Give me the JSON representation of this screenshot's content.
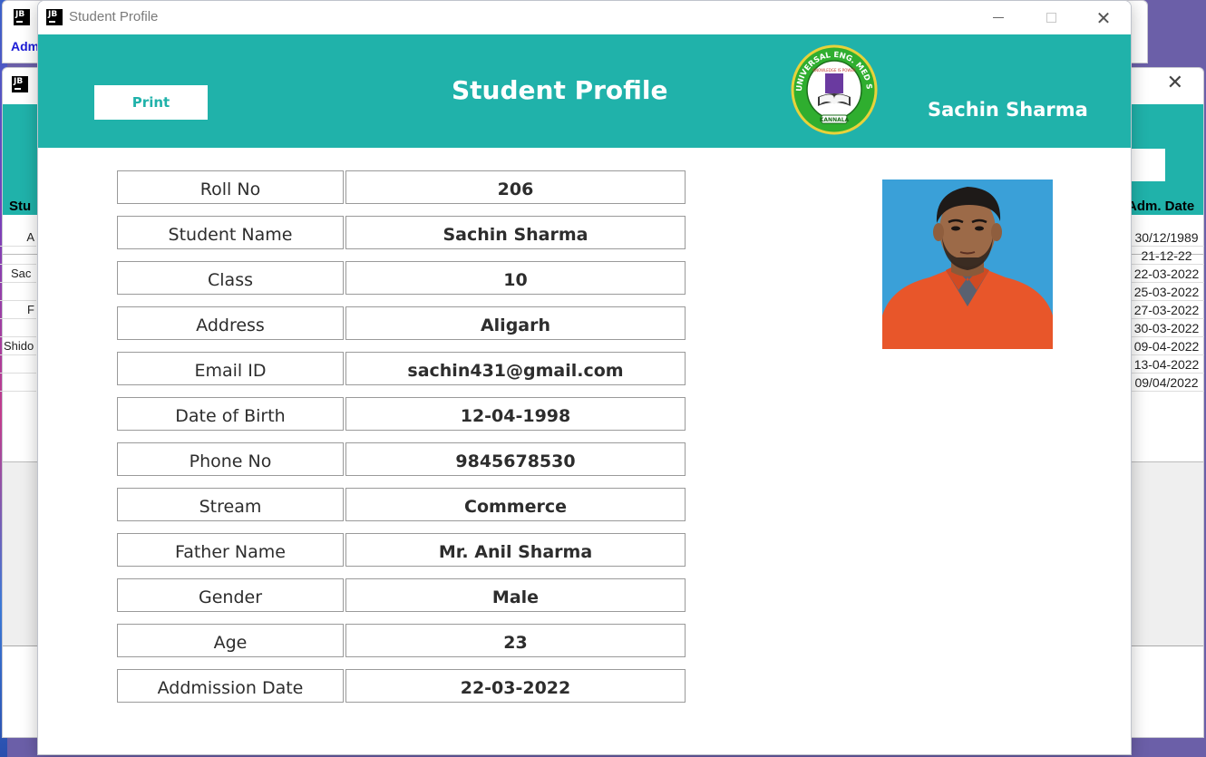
{
  "background": {
    "window1_menu_text": "Adm",
    "table_header_left": "Stu",
    "table_header_right": "Adm. Date",
    "button_fragment": "ile",
    "left_column": [
      "A",
      "",
      "Sac",
      "",
      "F",
      "",
      "Shido",
      "",
      ""
    ],
    "right_column": [
      "30/12/1989",
      "21-12-22",
      "22-03-2022",
      "25-03-2022",
      "27-03-2022",
      "30-03-2022",
      "09-04-2022",
      "13-04-2022",
      "09/04/2022"
    ]
  },
  "window": {
    "title": "Student Profile",
    "icon": "jetbrains-icon"
  },
  "header": {
    "print_label": "Print",
    "title": "Student Profile",
    "student_name": "Sachin Sharma",
    "logo": {
      "top_text": "UNIVERSAL ENG. MED SCHOOL",
      "motto": "KNOWLEDGE IS POWER",
      "bottom_text": "KANNALA"
    }
  },
  "profile": [
    {
      "label": "Roll No",
      "value": "206"
    },
    {
      "label": "Student Name",
      "value": "Sachin Sharma"
    },
    {
      "label": "Class",
      "value": "10"
    },
    {
      "label": "Address",
      "value": "Aligarh"
    },
    {
      "label": "Email ID",
      "value": "sachin431@gmail.com"
    },
    {
      "label": "Date of Birth",
      "value": "12-04-1998"
    },
    {
      "label": "Phone No",
      "value": "9845678530"
    },
    {
      "label": "Stream",
      "value": "Commerce"
    },
    {
      "label": "Father Name",
      "value": "Mr. Anil Sharma"
    },
    {
      "label": "Gender",
      "value": "Male"
    },
    {
      "label": "Age",
      "value": "23"
    },
    {
      "label": "Addmission Date",
      "value": "22-03-2022"
    }
  ],
  "colors": {
    "accent": "#20b2aa",
    "photo_background": "#3aa0d8"
  }
}
